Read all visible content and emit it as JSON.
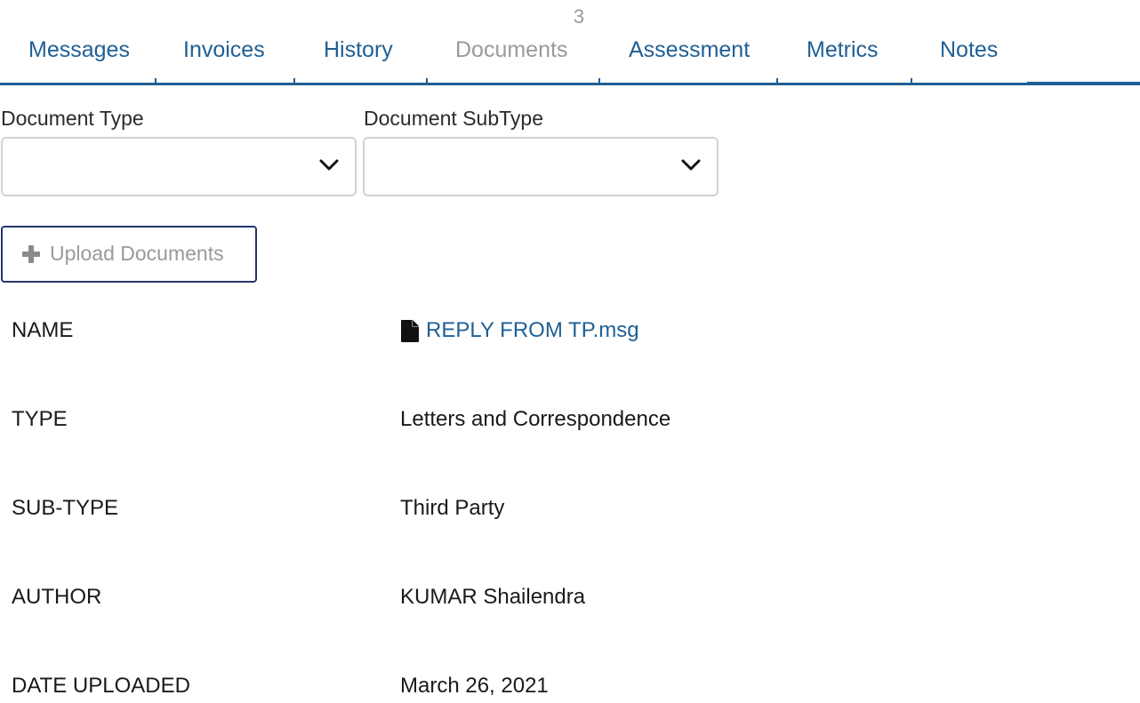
{
  "tabs": {
    "badge": "3",
    "items": [
      {
        "label": "Messages"
      },
      {
        "label": "Invoices"
      },
      {
        "label": "History"
      },
      {
        "label": "Documents"
      },
      {
        "label": "Assessment"
      },
      {
        "label": "Metrics"
      },
      {
        "label": "Notes"
      }
    ]
  },
  "filters": {
    "document_type_label": "Document Type",
    "document_type_value": "",
    "document_subtype_label": "Document SubType",
    "document_subtype_value": ""
  },
  "upload": {
    "label": "Upload Documents",
    "icon": "plus-icon"
  },
  "details": {
    "name_label": "NAME",
    "name_value": "REPLY FROM TP.msg",
    "name_icon": "file-icon",
    "type_label": "TYPE",
    "type_value": "Letters and Correspondence",
    "subtype_label": "SUB-TYPE",
    "subtype_value": "Third Party",
    "author_label": "AUTHOR",
    "author_value": "KUMAR Shailendra",
    "date_label": "DATE UPLOADED",
    "date_value": "March 26, 2021"
  },
  "colors": {
    "accent": "#1f5f95",
    "muted": "#9a9a9a",
    "button_border": "#24356e"
  }
}
